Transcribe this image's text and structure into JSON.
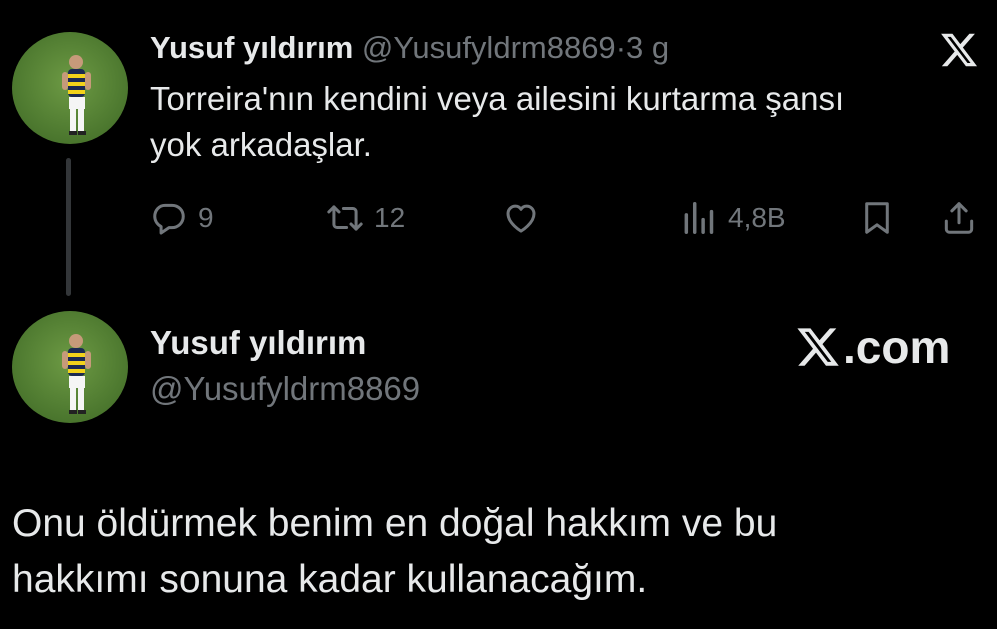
{
  "tweet": {
    "author_name": "Yusuf yıldırım",
    "handle": "@Yusufyldrm8869",
    "separator": "·",
    "time": "3 g",
    "text_line1": "Torreira'nın kendini veya ailesini kurtarma şansı",
    "text_line2": "yok arkadaşlar.",
    "stats": {
      "replies": "9",
      "retweets": "12",
      "views": "4,8B"
    },
    "logo_icon": "x-logo-icon"
  },
  "profile": {
    "name": "Yusuf yıldırım",
    "handle": "@Yusufyldrm8869",
    "site_label": ".com"
  },
  "quote": {
    "line1": "Onu öldürmek benim en doğal hakkım ve bu",
    "line2": "hakkımı sonuna kadar kullanacağım."
  },
  "colors": {
    "background": "#000000",
    "primary_text": "#e7e9ea",
    "secondary_text": "#71767b",
    "thread_line": "#333639"
  }
}
